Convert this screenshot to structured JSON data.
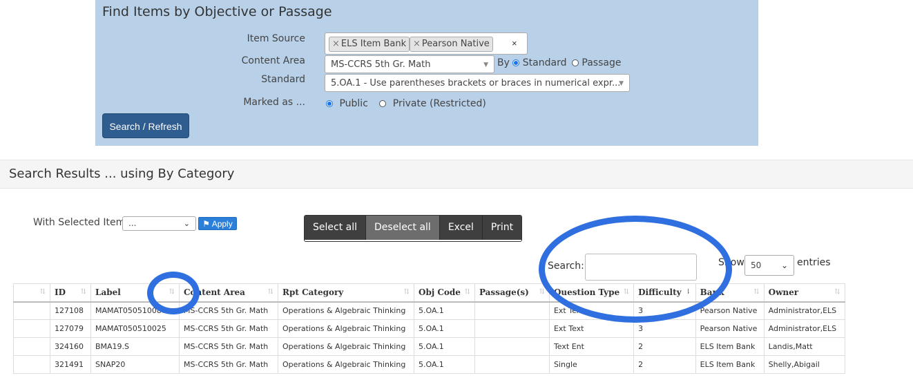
{
  "panel": {
    "title": "Find Items by Objective or Passage",
    "item_source_label": "Item Source",
    "content_area_label": "Content Area",
    "standard_label": "Standard",
    "marked_as_label": "Marked as ...",
    "item_sources": [
      "ELS Item Bank",
      "Pearson Native"
    ],
    "tag_clear": "×",
    "content_area_value": "MS-CCRS 5th Gr. Math",
    "by_label": "By",
    "by_options": [
      "Standard",
      "Passage"
    ],
    "by_selected": "Standard",
    "standard_value": "5.OA.1 - Use parentheses brackets or braces in numerical expr...",
    "marked_options": [
      "Public",
      "Private (Restricted)"
    ],
    "marked_selected": "Public",
    "search_button": "Search / Refresh"
  },
  "results": {
    "title": "Search Results ... using By Category",
    "with_selected_label": "With Selected Items",
    "with_selected_value": "...",
    "apply_label": "Apply",
    "buttons": [
      "Select all",
      "Deselect all",
      "Excel",
      "Print"
    ],
    "search_label": "Search:",
    "search_value": "",
    "show_label": "Show",
    "entries_value": "50",
    "entries_label": "entries"
  },
  "table": {
    "columns": [
      "",
      "ID",
      "Label",
      "Content Area",
      "Rpt Category",
      "Obj Code",
      "Passage(s)",
      "Question Type",
      "Difficulty",
      "Bank",
      "Owner"
    ],
    "rows": [
      [
        "",
        "127108",
        "MAMAT050510080",
        "MS-CCRS 5th Gr. Math",
        "Operations & Algebraic Thinking",
        "5.OA.1",
        "",
        "Ext Text",
        "3",
        "Pearson Native",
        "Administrator,ELS"
      ],
      [
        "",
        "127079",
        "MAMAT050510025",
        "MS-CCRS 5th Gr. Math",
        "Operations & Algebraic Thinking",
        "5.OA.1",
        "",
        "Ext Text",
        "3",
        "Pearson Native",
        "Administrator,ELS"
      ],
      [
        "",
        "324160",
        "BMA19.S",
        "MS-CCRS 5th Gr. Math",
        "Operations & Algebraic Thinking",
        "5.OA.1",
        "",
        "Text Ent",
        "2",
        "ELS Item Bank",
        "Landis,Matt"
      ],
      [
        "",
        "321491",
        "SNAP20",
        "MS-CCRS 5th Gr. Math",
        "Operations & Algebraic Thinking",
        "5.OA.1",
        "",
        "Single",
        "2",
        "ELS Item Bank",
        "Shelly,Abigail"
      ]
    ]
  },
  "colors": {
    "panel_bg": "#b8d0e8",
    "primary": "#2f5d8f",
    "annotation_ring": "#2f6fe0"
  }
}
